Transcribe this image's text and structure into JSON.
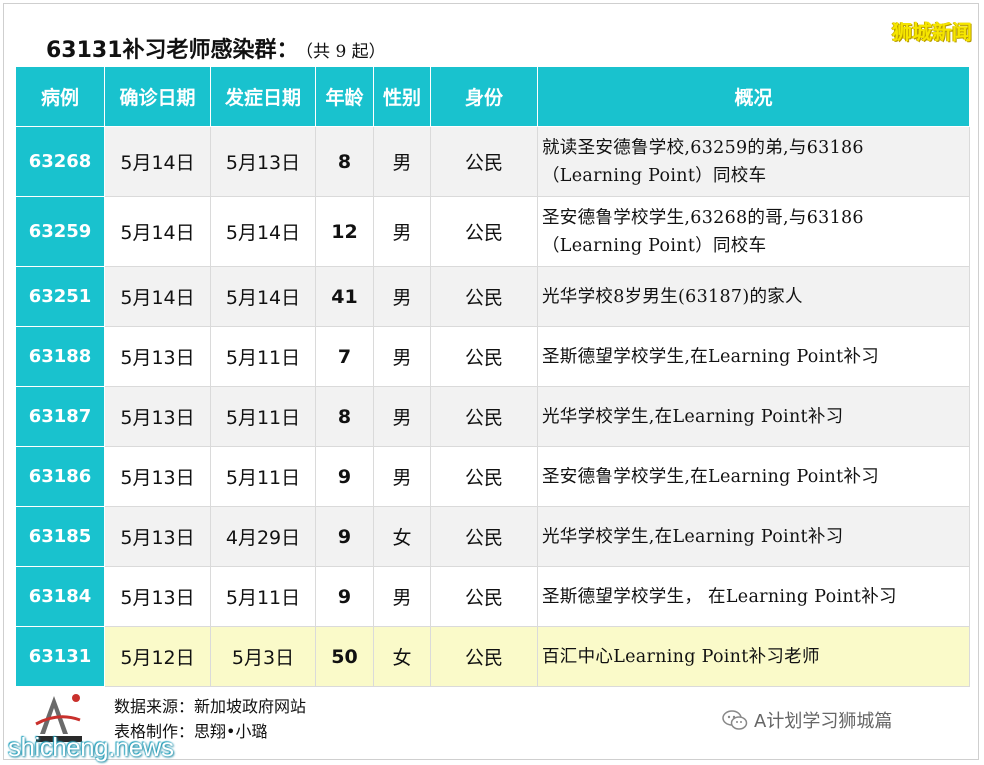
{
  "brand": "狮城新闻",
  "title": "63131补习老师感染群：",
  "title_count": "（共 9 起）",
  "headers": [
    "病例",
    "确诊日期",
    "发症日期",
    "年龄",
    "性别",
    "身份",
    "概况"
  ],
  "rows": [
    {
      "case": "63268",
      "confirmed": "5月14日",
      "onset": "5月13日",
      "age": "8",
      "sex": "男",
      "status": "公民",
      "summary_line1": "就读圣安德鲁学校,63259的弟,与63186",
      "summary_line2": "（Learning Point）同校车"
    },
    {
      "case": "63259",
      "confirmed": "5月14日",
      "onset": "5月14日",
      "age": "12",
      "sex": "男",
      "status": "公民",
      "summary_line1": "圣安德鲁学校学生,63268的哥,与63186",
      "summary_line2": "（Learning Point）同校车"
    },
    {
      "case": "63251",
      "confirmed": "5月14日",
      "onset": "5月14日",
      "age": "41",
      "sex": "男",
      "status": "公民",
      "summary_line1": "光华学校8岁男生(63187)的家人",
      "summary_line2": ""
    },
    {
      "case": "63188",
      "confirmed": "5月13日",
      "onset": "5月11日",
      "age": "7",
      "sex": "男",
      "status": "公民",
      "summary_line1": "圣斯德望学校学生,在Learning Point补习",
      "summary_line2": ""
    },
    {
      "case": "63187",
      "confirmed": "5月13日",
      "onset": "5月11日",
      "age": "8",
      "sex": "男",
      "status": "公民",
      "summary_line1": "光华学校学生,在Learning Point补习",
      "summary_line2": ""
    },
    {
      "case": "63186",
      "confirmed": "5月13日",
      "onset": "5月11日",
      "age": "9",
      "sex": "男",
      "status": "公民",
      "summary_line1": "圣安德鲁学校学生,在Learning Point补习",
      "summary_line2": ""
    },
    {
      "case": "63185",
      "confirmed": "5月13日",
      "onset": "4月29日",
      "age": "9",
      "sex": "女",
      "status": "公民",
      "summary_line1": "光华学校学生,在Learning Point补习",
      "summary_line2": ""
    },
    {
      "case": "63184",
      "confirmed": "5月13日",
      "onset": "5月11日",
      "age": "9",
      "sex": "男",
      "status": "公民",
      "summary_line1": "圣斯德望学校学生， 在Learning Point补习",
      "summary_line2": ""
    },
    {
      "case": "63131",
      "confirmed": "5月12日",
      "onset": "5月3日",
      "age": "50",
      "sex": "女",
      "status": "公民",
      "summary_line1": "百汇中心Learning Point补习老师",
      "summary_line2": ""
    }
  ],
  "footer": {
    "source": "数据来源：新加坡政府网站",
    "maker": "表格制作：思翔•小璐"
  },
  "wechat_account": "A计划学习狮城篇",
  "watermark": "shicheng.news",
  "colors": {
    "header_bg": "#19c2ce",
    "highlight_row": "#fafac9",
    "brand": "#f6e600"
  }
}
